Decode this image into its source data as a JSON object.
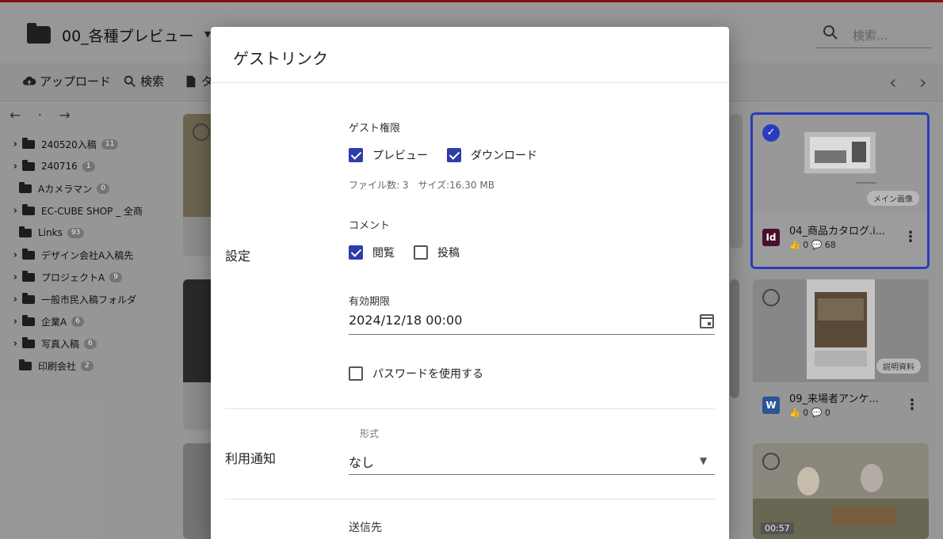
{
  "header": {
    "folder_title": "00_各種プレビュー",
    "search_placeholder": "検索..."
  },
  "toolbar": {
    "upload": "アップロード",
    "search": "検索",
    "partial": "タ"
  },
  "sidebar": {
    "nav": "← · →",
    "items": [
      {
        "label": "240520入稿",
        "count": "11",
        "expandable": true
      },
      {
        "label": "240716",
        "count": "1",
        "expandable": true
      },
      {
        "label": "Aカメラマン",
        "count": "0",
        "expandable": false
      },
      {
        "label": "EC-CUBE SHOP _ 全商",
        "count": "",
        "expandable": true
      },
      {
        "label": "Links",
        "count": "93",
        "expandable": false
      },
      {
        "label": "デザイン会社A入稿先",
        "count": "",
        "expandable": true
      },
      {
        "label": "プロジェクトA",
        "count": "9",
        "expandable": true
      },
      {
        "label": "一般市民入稿フォルダ",
        "count": "",
        "expandable": true
      },
      {
        "label": "企業A",
        "count": "6",
        "expandable": true
      },
      {
        "label": "写真入稿",
        "count": "6",
        "expandable": true
      },
      {
        "label": "印刷会社",
        "count": "2",
        "expandable": false
      }
    ]
  },
  "cards": [
    {
      "name": "04_商品カタログ.i...",
      "likes": "0",
      "comments": "68",
      "badge": "Id",
      "badge_color": "#4a1030",
      "tag": "メイン画像",
      "selected": true
    },
    {
      "name": "09_来場者アンケ...",
      "likes": "0",
      "comments": "0",
      "badge": "W",
      "badge_color": "#2b579a",
      "tag": "説明資料",
      "selected": false
    },
    {
      "name": "",
      "duration": "00:57",
      "selected": false
    }
  ],
  "dialog": {
    "title": "ゲストリンク",
    "settings_label": "設定",
    "guest_permission_label": "ゲスト権限",
    "preview_label": "プレビュー",
    "preview_checked": true,
    "download_label": "ダウンロード",
    "download_checked": true,
    "file_meta": "ファイル数: 3　サイズ:16.30 MB",
    "comment_label": "コメント",
    "view_label": "閲覧",
    "view_checked": true,
    "post_label": "投稿",
    "post_checked": false,
    "expiry_label": "有効期限",
    "expiry_value": "2024/12/18 00:00",
    "password_label": "パスワードを使用する",
    "password_checked": false,
    "notify_label": "利用通知",
    "format_caption": "形式",
    "format_value": "なし",
    "recipient_label": "送信先"
  },
  "colors": {
    "accent": "#2d3ea8",
    "topbar_line": "#8b1010"
  }
}
